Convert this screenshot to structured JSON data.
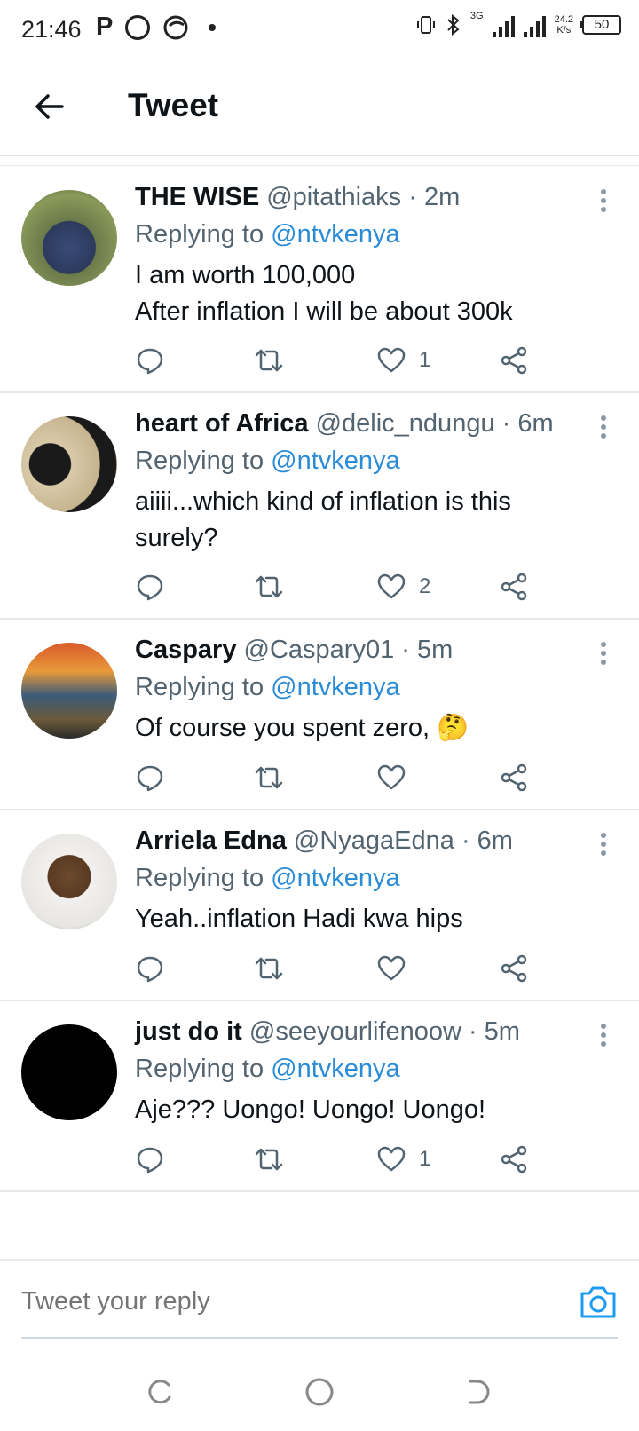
{
  "status_bar": {
    "time": "21:46",
    "app_letter": "P",
    "network": "3G",
    "speed_value": "24.2",
    "speed_unit": "K/s",
    "battery": "50"
  },
  "header": {
    "title": "Tweet"
  },
  "reply_to": "@ntvkenya",
  "replying_label": "Replying to ",
  "tweets": [
    {
      "name": "THE WISE",
      "handle": "@pitathiaks",
      "time": "· 2m",
      "body_lines": [
        "I am worth 100,000",
        "After inflation I will be about 300k"
      ],
      "likes": "1"
    },
    {
      "name": "heart of Africa",
      "handle": "@delic_ndungu",
      "time": "· 6m",
      "body_lines": [
        "aiiii...which kind of inflation is this",
        "surely?"
      ],
      "likes": "2"
    },
    {
      "name": "Caspary",
      "handle": "@Caspary01",
      "time": "· 5m",
      "body_lines": [
        "Of course you spent zero, 🤔"
      ],
      "likes": ""
    },
    {
      "name": "Arriela Edna",
      "handle": "@NyagaEdna",
      "time": "· 6m",
      "body_lines": [
        "Yeah..inflation Hadi kwa hips"
      ],
      "likes": ""
    },
    {
      "name": "just do it",
      "handle": "@seeyourlifenoow",
      "time": "· 5m",
      "body_lines": [
        "Aje??? Uongo! Uongo! Uongo!"
      ],
      "likes": "1"
    }
  ],
  "reply_bar": {
    "placeholder": "Tweet your reply"
  },
  "colors": {
    "accent": "#1d9bf0",
    "text": "#0f1419",
    "muted": "#536471",
    "divider": "#e6e9ec"
  },
  "icons": {
    "back": "arrow-left-icon",
    "reply": "comment-bubble-icon",
    "retweet": "retweet-icon",
    "like": "heart-icon",
    "share": "share-icon",
    "more": "more-vertical-icon",
    "camera": "camera-icon"
  }
}
